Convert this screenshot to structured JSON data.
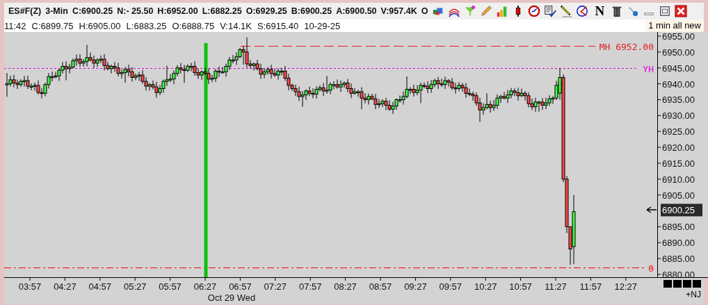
{
  "header": {
    "symbol": "ES#F(Z)",
    "interval": "3-Min",
    "quote": [
      "C:6900.25",
      "N:- 25.50",
      "H:6952.00",
      "L:6882.25",
      "O:6929.25",
      "B:6900.25",
      "A:6900.50",
      "V:957.4K",
      "O"
    ],
    "toolbar_letter": "N"
  },
  "bar_info": [
    "11:42",
    "C:6899.75",
    "H:6905.00",
    "L:6883.25",
    "O:6888.75",
    "V:14.1K",
    "S:6915.40",
    "10-29-25"
  ],
  "tooltip": "1 min all new",
  "chart": {
    "price_ticks": [
      "6955.00",
      "6950.00",
      "6945.00",
      "6940.00",
      "6935.00",
      "6930.00",
      "6925.00",
      "6920.00",
      "6915.00",
      "6910.00",
      "6905.00",
      "6895.00",
      "6890.00",
      "6885.00",
      "6880.00"
    ],
    "current_price": "6900.25",
    "time_ticks": [
      "03:57",
      "04:27",
      "04:57",
      "05:27",
      "05:57",
      "06:27",
      "06:57",
      "07:27",
      "07:57",
      "08:27",
      "08:57",
      "09:27",
      "09:57",
      "10:27",
      "10:57",
      "11:27",
      "11:57",
      "12:27"
    ],
    "date_label": "Oct 29 Wed",
    "levels": [
      {
        "label": "MH 6952.00",
        "kind": "dashed",
        "color": "#e02020"
      },
      {
        "label": "YH",
        "kind": "dotted",
        "color": "#e000e0"
      },
      {
        "label": "0",
        "kind": "dashdot",
        "color": "#ff0000"
      }
    ]
  },
  "footer": {
    "tag": "+NJ"
  }
}
